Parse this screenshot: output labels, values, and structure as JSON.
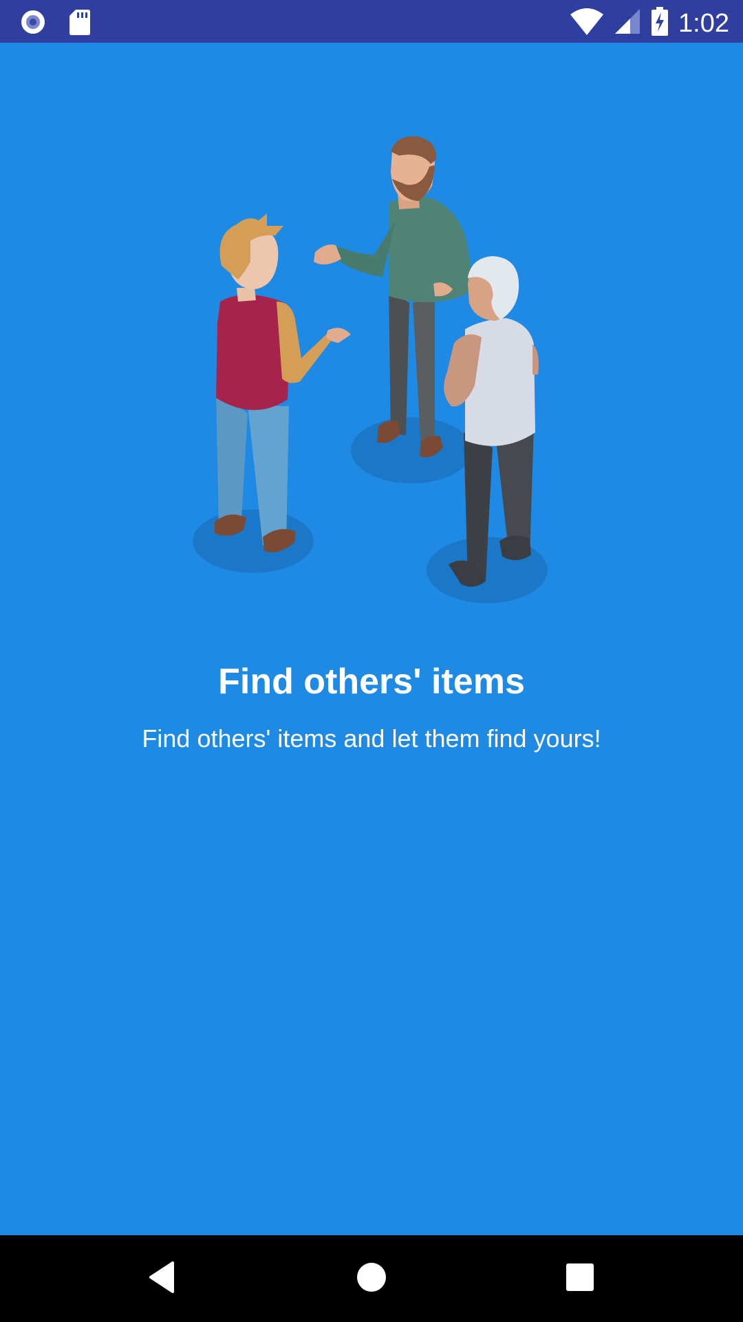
{
  "status_bar": {
    "time": "1:02",
    "icons": [
      "record-icon",
      "sd-card-icon",
      "wifi-icon",
      "cellular-signal-icon",
      "battery-charging-icon"
    ]
  },
  "onboarding": {
    "illustration": "three-people-talking-illustration",
    "title": "Find others' items",
    "subtitle": "Find others' items and let them find yours!"
  },
  "nav_bar": {
    "buttons": [
      "back-icon",
      "home-icon",
      "recents-icon"
    ]
  },
  "colors": {
    "background": "#1f8ae4",
    "status_bar": "#303f9f",
    "nav_bar": "#000000"
  }
}
